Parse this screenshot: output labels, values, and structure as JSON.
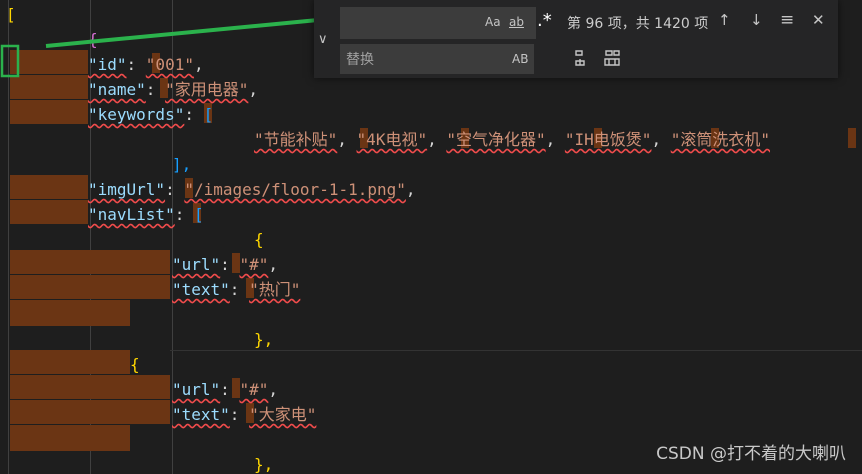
{
  "code": {
    "l1": "[",
    "l2": "{",
    "l3_key": "\"id\"",
    "l3_val": "\"001\"",
    "l4_key": "\"name\"",
    "l4_val": "\"家用电器\"",
    "l5_key": "\"keywords\"",
    "l5_open": "[",
    "l6": [
      "\"节能补贴\"",
      "\"4K电视\"",
      "\"空气净化器\"",
      "\"IH电饭煲\"",
      "\"滚筒洗衣机\""
    ],
    "l7_close": "],",
    "l8_key": "\"imgUrl\"",
    "l8_val": "\"/images/floor-1-1.png\"",
    "l9_key": "\"navList\"",
    "l9_open": "[",
    "l10": "{",
    "l11_key": "\"url\"",
    "l11_val": "\"#\"",
    "l12_key": "\"text\"",
    "l12_val": "\"热门\"",
    "l14": "},",
    "l15": "{",
    "l16_key": "\"url\"",
    "l16_val": "\"#\"",
    "l17_key": "\"text\"",
    "l17_val": "\"大家电\"",
    "l19": "},"
  },
  "find_widget": {
    "find_value": "",
    "replace_placeholder": "替换",
    "match_case": "Aa",
    "whole_word": "ab",
    "regex": ".*",
    "match_count": "第 96 项，共 1420 项",
    "prev_icon": "↑",
    "next_icon": "↓",
    "selection_icon": "≡",
    "close_icon": "✕",
    "toggle_icon": "∨",
    "preserve_case": "AB"
  },
  "colors": {
    "highlight": "#6b3514",
    "arrow": "#2bb24c",
    "bracket": "#ffd700"
  },
  "watermark": "CSDN @打不着的大喇叭"
}
